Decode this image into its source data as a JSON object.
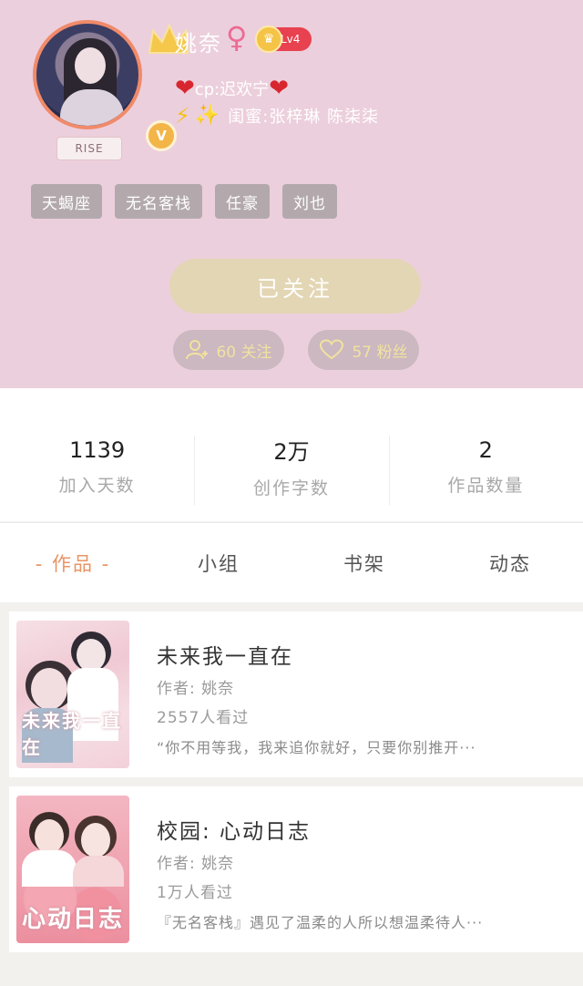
{
  "profile": {
    "name": "姚奈",
    "gender_symbol": "♀",
    "level": "Lv4",
    "vip_badge": "V",
    "badge_text": "RISE",
    "cp_line": "cp:迟欢宁",
    "bestie_line": "闺蜜:张梓琳 陈柒柒"
  },
  "tags": [
    "天蝎座",
    "无名客栈",
    "任豪",
    "刘也"
  ],
  "actions": {
    "follow_button": "已关注",
    "following": "60 关注",
    "fans": "57 粉丝"
  },
  "stats": [
    {
      "value": "1139",
      "label": "加入天数"
    },
    {
      "value": "2万",
      "label": "创作字数"
    },
    {
      "value": "2",
      "label": "作品数量"
    }
  ],
  "tabs": [
    "- 作品 -",
    "小组",
    "书架",
    "动态"
  ],
  "books": [
    {
      "title": "未来我一直在",
      "author": "作者: 姚奈",
      "views": "2557人看过",
      "desc": "“你不用等我，我来追你就好，只要你别推开···",
      "cover_text": "未来我一直在"
    },
    {
      "title": "校园: 心动日志",
      "author": "作者: 姚奈",
      "views": "1万人看过",
      "desc": "『无名客栈』遇见了温柔的人所以想温柔待人···",
      "cover_text": "心动日志"
    }
  ],
  "colors": {
    "header_bg": "#eccfdc",
    "active_tab": "#e89464",
    "follow_button_bg": "#e3d6b4",
    "level_badge": "#e8414f"
  }
}
